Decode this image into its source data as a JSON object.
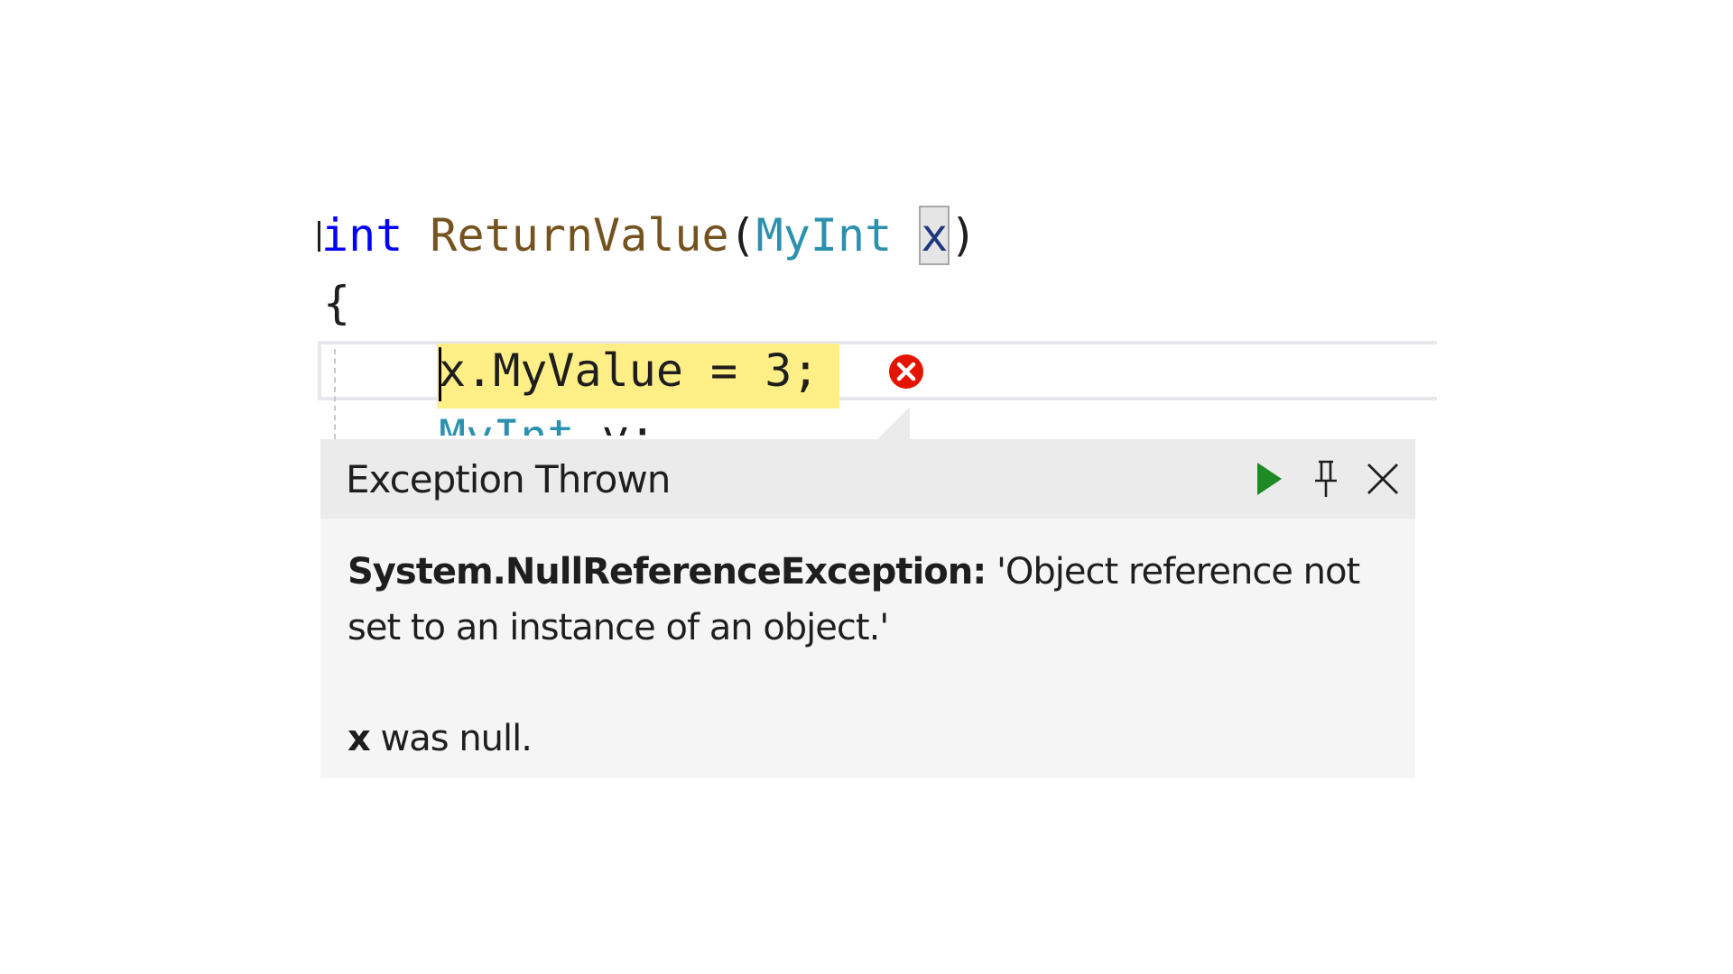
{
  "code": {
    "line1": {
      "keyword": "int",
      "method": "ReturnValue",
      "open_paren": "(",
      "param_type": "MyInt",
      "param_name": "x",
      "close_paren": ")"
    },
    "line2": {
      "text": "{"
    },
    "line3": {
      "statement": "x.MyValue = 3;"
    },
    "line4": {
      "type": "MyInt",
      "rest": " y;"
    }
  },
  "popup": {
    "title": "Exception Thrown",
    "exception_type": "System.NullReferenceException:",
    "exception_message": "'Object reference not set to an instance of an object.'",
    "detail_var": "x",
    "detail_text": "was null.",
    "buttons": {
      "continue_icon": "play-icon",
      "pin_icon": "pin-icon",
      "close_icon": "close-icon"
    }
  },
  "colors": {
    "keyword": "#0000ff",
    "method": "#74531f",
    "type": "#2b91af",
    "param": "#1f377f",
    "exec_highlight": "#ffef86",
    "error": "#e51400",
    "continue_green": "#1e8a23"
  }
}
